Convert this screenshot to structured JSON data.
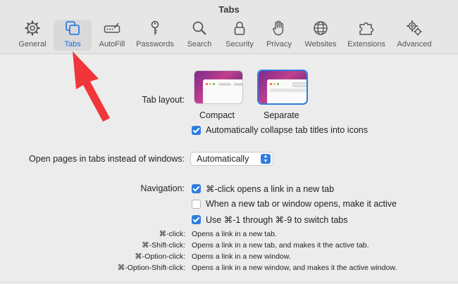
{
  "window": {
    "title": "Tabs"
  },
  "toolbar": {
    "items": [
      {
        "label": "General",
        "icon": "gear-icon"
      },
      {
        "label": "Tabs",
        "icon": "tabs-icon",
        "active": true
      },
      {
        "label": "AutoFill",
        "icon": "autofill-icon"
      },
      {
        "label": "Passwords",
        "icon": "key-icon"
      },
      {
        "label": "Search",
        "icon": "magnifier-icon"
      },
      {
        "label": "Security",
        "icon": "lock-icon"
      },
      {
        "label": "Privacy",
        "icon": "hand-icon"
      },
      {
        "label": "Websites",
        "icon": "globe-icon"
      },
      {
        "label": "Extensions",
        "icon": "puzzle-icon"
      },
      {
        "label": "Advanced",
        "icon": "gears-icon"
      }
    ]
  },
  "tab_layout": {
    "label": "Tab layout:",
    "options": [
      {
        "label": "Compact",
        "selected": false
      },
      {
        "label": "Separate",
        "selected": true
      }
    ],
    "collapse_checkbox": {
      "label": "Automatically collapse tab titles into icons",
      "checked": true
    }
  },
  "open_pages": {
    "label": "Open pages in tabs instead of windows:",
    "value": "Automatically"
  },
  "navigation": {
    "label": "Navigation:",
    "checkboxes": [
      {
        "label": "⌘-click opens a link in a new tab",
        "checked": true
      },
      {
        "label": "When a new tab or window opens, make it active",
        "checked": false
      },
      {
        "label": "Use ⌘-1 through ⌘-9 to switch tabs",
        "checked": true
      }
    ]
  },
  "shortcuts": [
    {
      "key": "⌘-click:",
      "desc": "Opens a link in a new tab."
    },
    {
      "key": "⌘-Shift-click:",
      "desc": "Opens a link in a new tab, and makes it the active tab."
    },
    {
      "key": "⌘-Option-click:",
      "desc": "Opens a link in a new window."
    },
    {
      "key": "⌘-Option-Shift-click:",
      "desc": "Opens a link in a new window, and makes it the active window."
    }
  ],
  "colors": {
    "accent": "#2f7de1",
    "annotation_arrow": "#f0363a"
  }
}
